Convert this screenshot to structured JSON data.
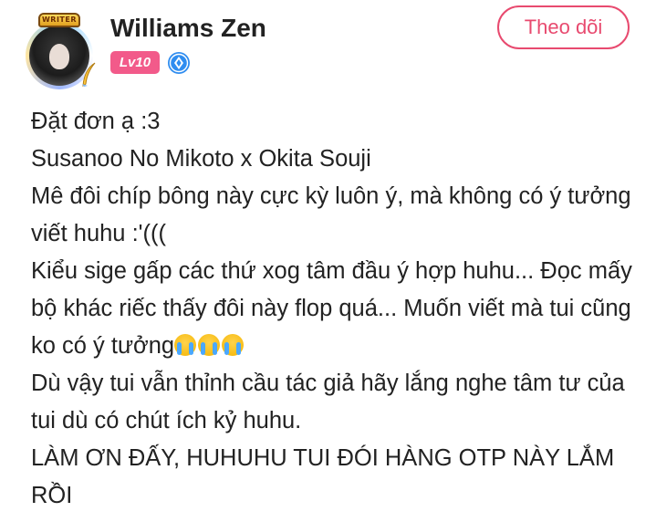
{
  "author": {
    "name": "Williams Zen",
    "avatar_badge": "WRITER",
    "level": "Lv10",
    "verified_icon": "blue-diamond-icon"
  },
  "follow_button": {
    "label": "Theo dõi"
  },
  "post": {
    "lines": [
      "Đặt đơn ạ :3",
      "Susanoo No Mikoto x Okita Souji",
      "Mê đôi chíp bông này cực kỳ luôn ý, mà không có ý tưởng viết huhu :'(((",
      "Kiểu sige gấp các thứ xog tâm đầu ý hợp huhu... Đọc mấy bộ khác riếc thấy đôi này flop quá... Muốn viết mà tui cũng ko có ý tưởng",
      "Dù vậy tui vẫn thỉnh cầu tác giả hãy lắng nghe tâm tư của tui dù có chút ích kỷ huhu.",
      "LÀM ƠN ĐẤY, HUHUHU TUI ĐÓI HÀNG OTP NÀY LẮM RỒI"
    ],
    "emoji_icon": "loudly-crying-face-icon"
  },
  "colors": {
    "accent_pink": "#e84a6f",
    "level_badge": "#f25a8a",
    "verified_blue": "#2f8df0"
  }
}
